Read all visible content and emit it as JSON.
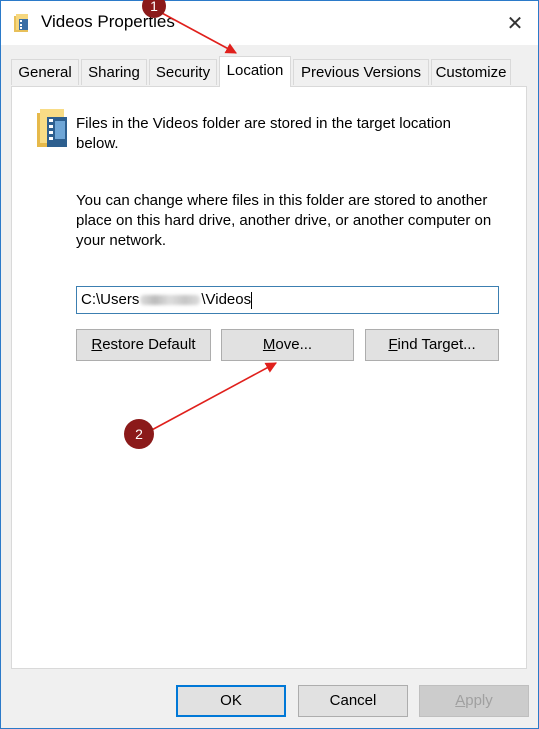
{
  "window": {
    "title": "Videos Properties",
    "close_glyph": "✕"
  },
  "tabs": [
    {
      "label": "General"
    },
    {
      "label": "Sharing"
    },
    {
      "label": "Security"
    },
    {
      "label": "Location"
    },
    {
      "label": "Previous Versions"
    },
    {
      "label": "Customize"
    }
  ],
  "active_tab": "Location",
  "location_panel": {
    "description": "Files in the Videos folder are stored in the target location below.",
    "info": "You can change where files in this folder are stored to another place on this hard drive, another drive, or another computer on your network.",
    "path_prefix": "C:\\Users",
    "path_suffix": "\\Videos",
    "restore_default": {
      "accel": "R",
      "rest": "estore Default"
    },
    "move": {
      "accel": "M",
      "rest": "ove..."
    },
    "find_target": {
      "accel": "F",
      "rest": "ind Target..."
    }
  },
  "footer": {
    "ok": "OK",
    "cancel": "Cancel",
    "apply": {
      "accel": "A",
      "rest": "pply"
    }
  },
  "annotations": {
    "marker_1": "1",
    "marker_2": "2",
    "marker_color": "#8b1a1a",
    "arrow_color": "#e0201c"
  },
  "icons": {
    "title": "video-folder-icon",
    "panel": "video-folder-icon",
    "close": "close-icon"
  }
}
